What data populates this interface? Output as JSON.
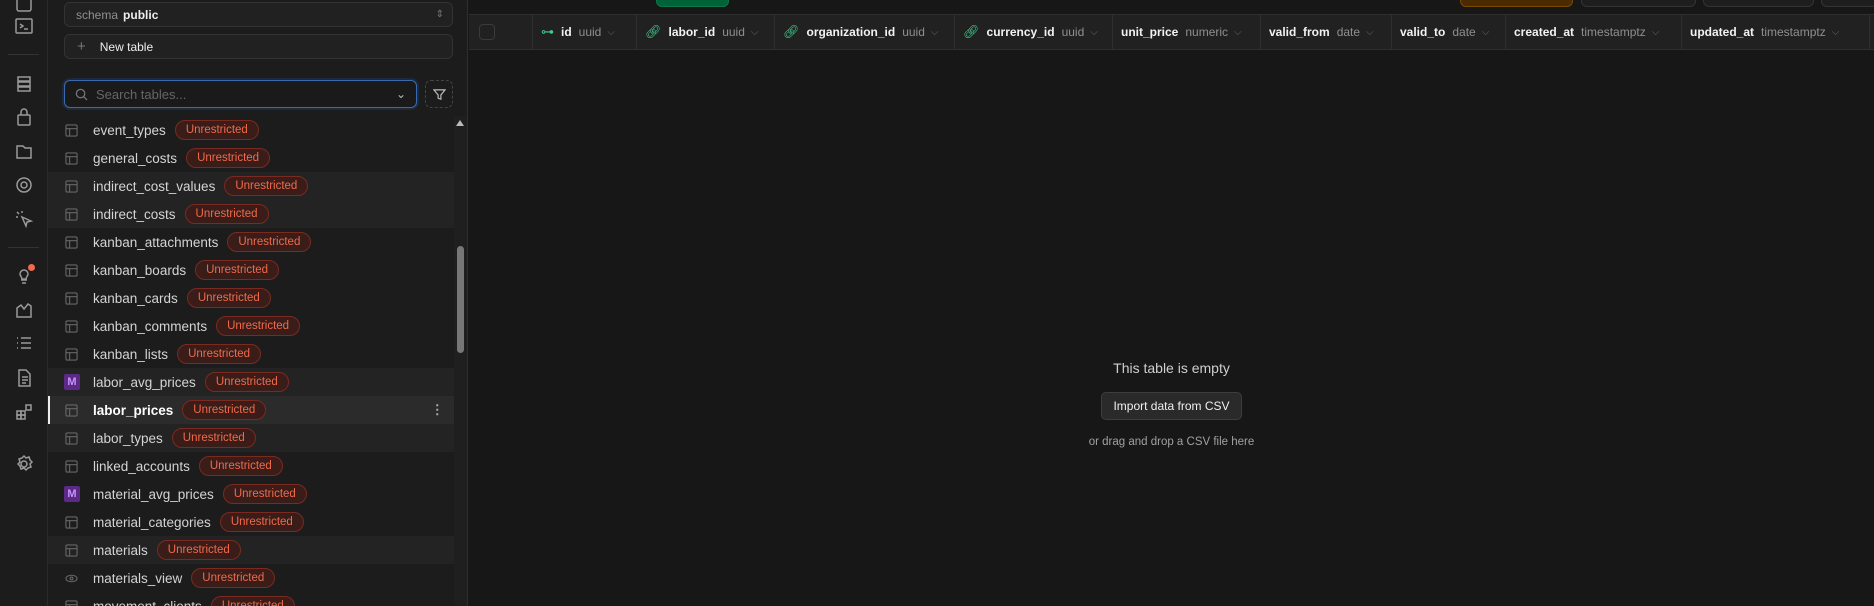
{
  "schema": {
    "label": "schema",
    "value": "public"
  },
  "new_table": "New table",
  "search": {
    "placeholder": "Search tables..."
  },
  "tables": [
    {
      "name": "event_types",
      "icon": "table",
      "badge": "Unrestricted"
    },
    {
      "name": "general_costs",
      "icon": "table",
      "badge": "Unrestricted"
    },
    {
      "name": "indirect_cost_values",
      "icon": "table",
      "badge": "Unrestricted"
    },
    {
      "name": "indirect_costs",
      "icon": "table",
      "badge": "Unrestricted"
    },
    {
      "name": "kanban_attachments",
      "icon": "table",
      "badge": "Unrestricted"
    },
    {
      "name": "kanban_boards",
      "icon": "table",
      "badge": "Unrestricted"
    },
    {
      "name": "kanban_cards",
      "icon": "table",
      "badge": "Unrestricted"
    },
    {
      "name": "kanban_comments",
      "icon": "table",
      "badge": "Unrestricted"
    },
    {
      "name": "kanban_lists",
      "icon": "table",
      "badge": "Unrestricted"
    },
    {
      "name": "labor_avg_prices",
      "icon": "materialized-view",
      "badge": "Unrestricted",
      "m": "M"
    },
    {
      "name": "labor_prices",
      "icon": "table",
      "badge": "Unrestricted"
    },
    {
      "name": "labor_types",
      "icon": "table",
      "badge": "Unrestricted"
    },
    {
      "name": "linked_accounts",
      "icon": "table",
      "badge": "Unrestricted"
    },
    {
      "name": "material_avg_prices",
      "icon": "materialized-view",
      "badge": "Unrestricted",
      "m": "M"
    },
    {
      "name": "material_categories",
      "icon": "table",
      "badge": "Unrestricted"
    },
    {
      "name": "materials",
      "icon": "table",
      "badge": "Unrestricted"
    },
    {
      "name": "materials_view",
      "icon": "view",
      "badge": "Unrestricted"
    },
    {
      "name": "movement_clients",
      "icon": "table",
      "badge": "Unrestricted"
    }
  ],
  "columns": [
    {
      "name": "id",
      "type": "uuid",
      "icon": "key"
    },
    {
      "name": "labor_id",
      "type": "uuid",
      "icon": "link"
    },
    {
      "name": "organization_id",
      "type": "uuid",
      "icon": "link"
    },
    {
      "name": "currency_id",
      "type": "uuid",
      "icon": "link"
    },
    {
      "name": "unit_price",
      "type": "numeric"
    },
    {
      "name": "valid_from",
      "type": "date"
    },
    {
      "name": "valid_to",
      "type": "date"
    },
    {
      "name": "created_at",
      "type": "timestamptz"
    },
    {
      "name": "updated_at",
      "type": "timestamptz"
    }
  ],
  "empty": {
    "title": "This table is empty",
    "button": "Import data from CSV",
    "hint": "or drag and drop a CSV file here"
  },
  "colors": {
    "accent": "#3ecf8e",
    "badge": "#f06a4b"
  }
}
